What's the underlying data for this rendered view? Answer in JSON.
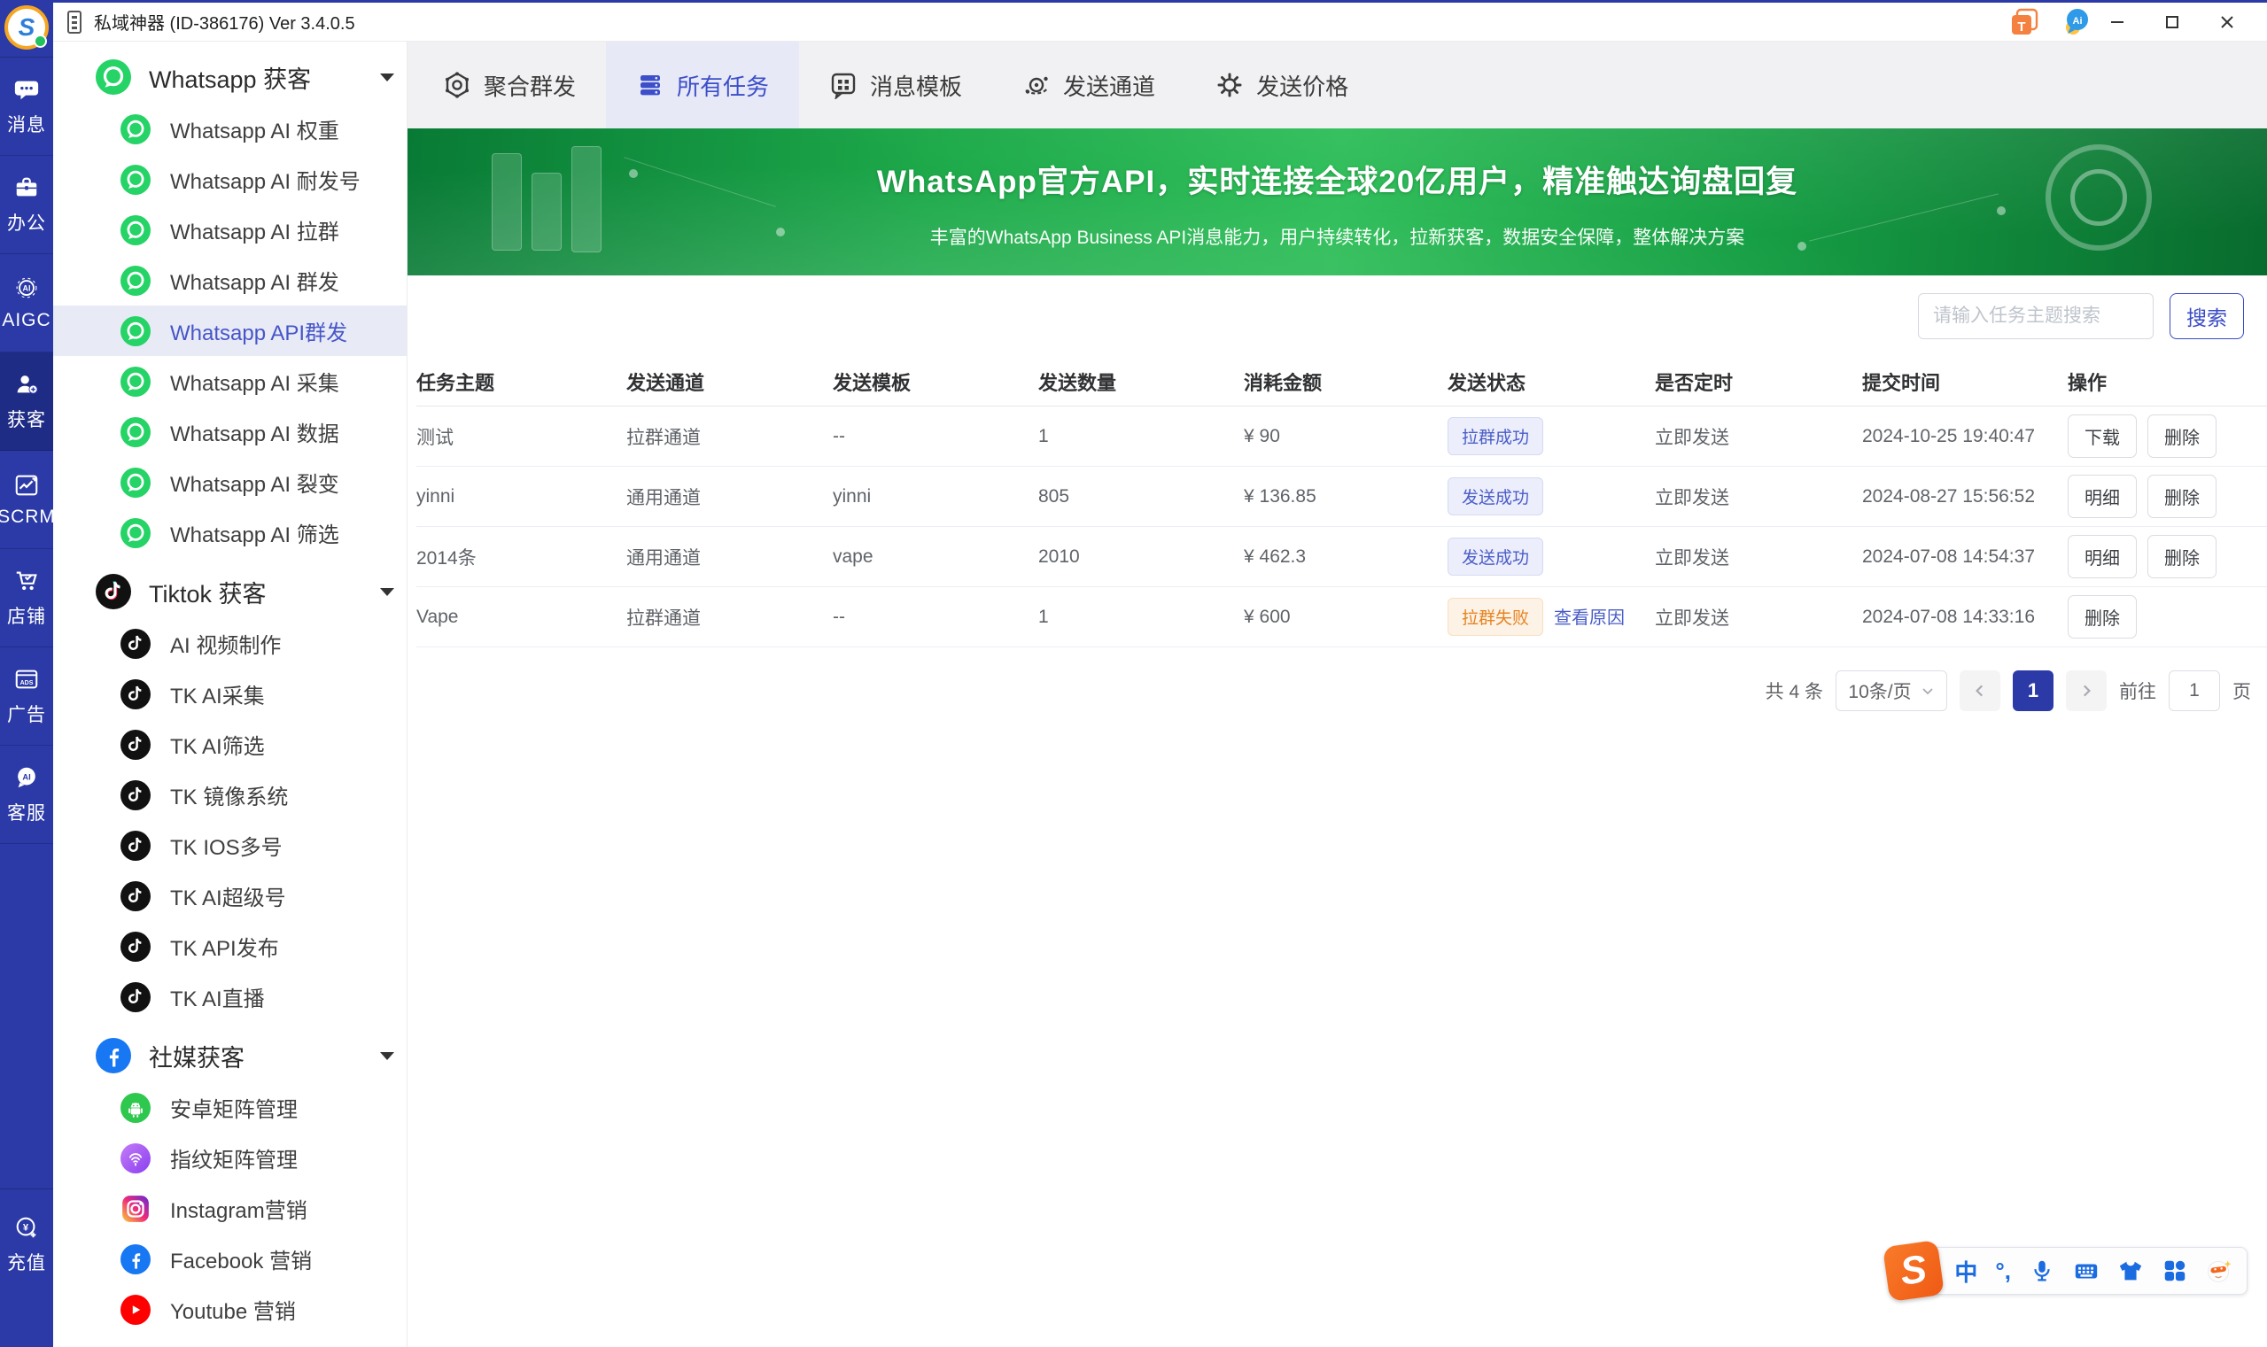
{
  "window": {
    "title": "私域神器 (ID-386176) Ver 3.4.0.5"
  },
  "brand": {
    "logo_letter": "S",
    "accent_blue": "#2c3aa8",
    "whatsapp_green": "#25d366",
    "banner_green": "#1fae4c",
    "fail_orange": "#e6831f"
  },
  "titlebar": {
    "ai_badge": "Ai",
    "translate_badge": "T"
  },
  "rail": {
    "items": [
      {
        "label": "消息"
      },
      {
        "label": "办公"
      },
      {
        "label": "AIGC"
      },
      {
        "label": "获客"
      },
      {
        "label": "SCRM"
      },
      {
        "label": "店铺"
      },
      {
        "label": "广告"
      },
      {
        "label": "客服"
      }
    ],
    "recharge_label": "充值"
  },
  "icon_text": {
    "aigc_badge": "AI",
    "ads_badge": "ADS",
    "ai_chat_badge": "AI",
    "yuan": "¥"
  },
  "sidebar": {
    "groups": [
      {
        "label": "Whatsapp 获客",
        "items": [
          {
            "label": "Whatsapp AI 权重"
          },
          {
            "label": "Whatsapp AI 耐发号"
          },
          {
            "label": "Whatsapp AI 拉群"
          },
          {
            "label": "Whatsapp AI 群发"
          },
          {
            "label": "Whatsapp API群发"
          },
          {
            "label": "Whatsapp AI 采集"
          },
          {
            "label": "Whatsapp AI 数据"
          },
          {
            "label": "Whatsapp AI 裂变"
          },
          {
            "label": "Whatsapp AI 筛选"
          }
        ]
      },
      {
        "label": "Tiktok 获客",
        "items": [
          {
            "label": "AI 视频制作"
          },
          {
            "label": "TK AI采集"
          },
          {
            "label": "TK AI筛选"
          },
          {
            "label": "TK 镜像系统"
          },
          {
            "label": "TK IOS多号"
          },
          {
            "label": "TK AI超级号"
          },
          {
            "label": "TK API发布"
          },
          {
            "label": "TK AI直播"
          }
        ]
      },
      {
        "label": "社媒获客",
        "items": [
          {
            "label": "安卓矩阵管理"
          },
          {
            "label": "指纹矩阵管理"
          },
          {
            "label": "Instagram营销"
          },
          {
            "label": "Facebook 营销"
          },
          {
            "label": "Youtube 营销"
          }
        ]
      }
    ]
  },
  "tabs": [
    {
      "label": "聚合群发"
    },
    {
      "label": "所有任务"
    },
    {
      "label": "消息模板"
    },
    {
      "label": "发送通道"
    },
    {
      "label": "发送价格"
    }
  ],
  "banner": {
    "title": "WhatsApp官方API，实时连接全球20亿用户，精准触达询盘回复",
    "subtitle": "丰富的WhatsApp Business API消息能力，用户持续转化，拉新获客，数据安全保障，整体解决方案"
  },
  "search": {
    "placeholder": "请输入任务主题搜索",
    "button": "搜索"
  },
  "table": {
    "headers": [
      "任务主题",
      "发送通道",
      "发送模板",
      "发送数量",
      "消耗金额",
      "发送状态",
      "是否定时",
      "提交时间",
      "操作"
    ],
    "rows": [
      {
        "topic": "测试",
        "channel": "拉群通道",
        "template": "--",
        "count": "1",
        "amount": "¥ 90",
        "status": "拉群成功",
        "status_variant": "success",
        "reason_link": "",
        "timing": "立即发送",
        "time": "2024-10-25 19:40:47",
        "actions": [
          "下载",
          "删除"
        ]
      },
      {
        "topic": "yinni",
        "channel": "通用通道",
        "template": "yinni",
        "count": "805",
        "amount": "¥ 136.85",
        "status": "发送成功",
        "status_variant": "success",
        "reason_link": "",
        "timing": "立即发送",
        "time": "2024-08-27 15:56:52",
        "actions": [
          "明细",
          "删除"
        ]
      },
      {
        "topic": "2014条",
        "channel": "通用通道",
        "template": "vape",
        "count": "2010",
        "amount": "¥ 462.3",
        "status": "发送成功",
        "status_variant": "success",
        "reason_link": "",
        "timing": "立即发送",
        "time": "2024-07-08 14:54:37",
        "actions": [
          "明细",
          "删除"
        ]
      },
      {
        "topic": "Vape",
        "channel": "拉群通道",
        "template": "--",
        "count": "1",
        "amount": "¥ 600",
        "status": "拉群失败",
        "status_variant": "fail",
        "reason_link": "查看原因",
        "timing": "立即发送",
        "time": "2024-07-08 14:33:16",
        "actions": [
          "删除"
        ]
      }
    ]
  },
  "pagination": {
    "total": "共 4 条",
    "page_size": "10条/页",
    "current": "1",
    "goto_label": "前往",
    "goto_value": "1",
    "unit": "页"
  },
  "ime": {
    "logo_letter": "S",
    "mode": "中",
    "punct": "°,"
  }
}
